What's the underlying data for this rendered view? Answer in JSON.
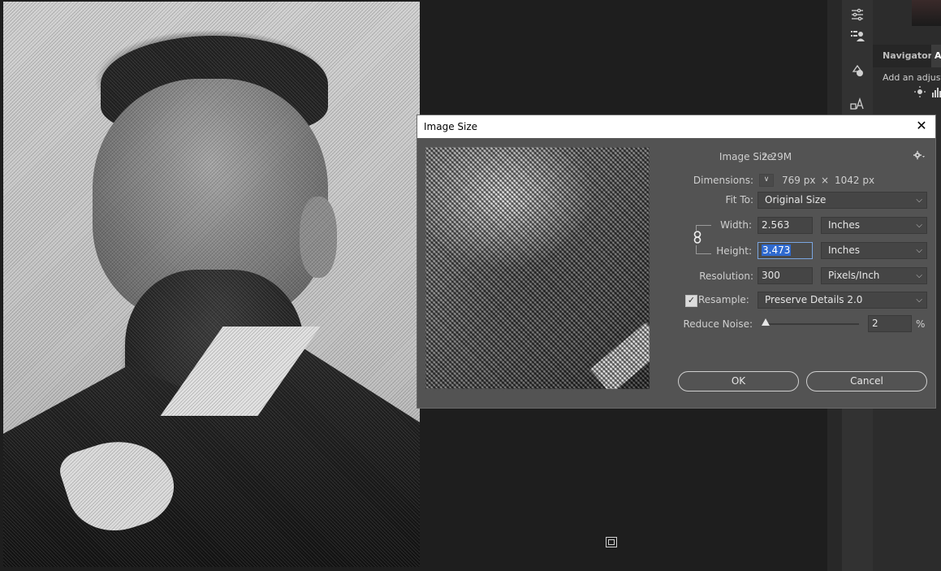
{
  "right_panel": {
    "tab_navigator": "Navigator",
    "tab_adjustments": "A",
    "adjust_hint": "Add an adjustm",
    "tool_icons": [
      "sliders-icon",
      "list-user-icon",
      "history-icon",
      "character-icon"
    ]
  },
  "dialog": {
    "title": "Image Size",
    "close_glyph": "✕",
    "image_size_label": "Image Size:",
    "image_size_value": "2.29M",
    "dimensions_label": "Dimensions:",
    "dimensions_width": "769 px",
    "dimensions_times": "×",
    "dimensions_height": "1042 px",
    "fit_to_label": "Fit To:",
    "fit_to_value": "Original Size",
    "width_label": "Width:",
    "width_value": "2.563",
    "width_unit": "Inches",
    "height_label": "Height:",
    "height_value": "3.473",
    "height_unit": "Inches",
    "resolution_label": "Resolution:",
    "resolution_value": "300",
    "resolution_unit": "Pixels/Inch",
    "resample_label": "Resample:",
    "resample_checked": true,
    "resample_value": "Preserve Details 2.0",
    "reduce_noise_label": "Reduce Noise:",
    "reduce_noise_value": "2",
    "reduce_noise_unit": "%",
    "ok_label": "OK",
    "cancel_label": "Cancel"
  },
  "colors": {
    "dialog_bg": "#535353",
    "workspace_bg": "#1e1e1e",
    "selection": "#2f6ad0"
  }
}
